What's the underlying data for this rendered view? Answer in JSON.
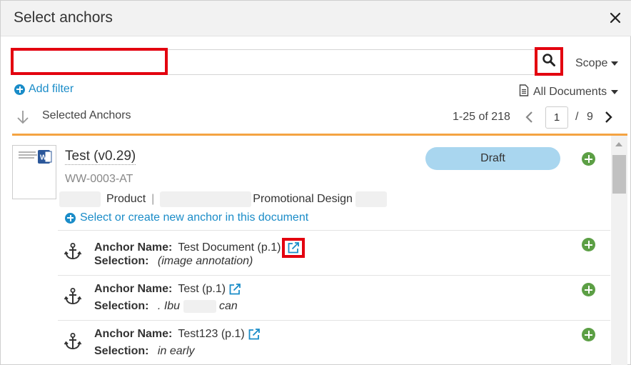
{
  "dialog": {
    "title": "Select anchors"
  },
  "search": {
    "value": "",
    "placeholder": "",
    "scope_label": "Scope"
  },
  "filters": {
    "add_filter_label": "Add filter",
    "all_documents_label": "All Documents"
  },
  "selection_bar": {
    "selected_label": "Selected Anchors",
    "range": "1-25 of 218",
    "current_page": "1",
    "separator": "/",
    "total_pages": "9"
  },
  "document": {
    "title": "Test (v0.29)",
    "id": "WW-0003-AT",
    "type": "Product",
    "subtype": "Promotional Design",
    "status": "Draft",
    "select_create_label": "Select or create new anchor in this document"
  },
  "anchors": [
    {
      "name_label": "Anchor Name:",
      "name": "Test Document (p.1)",
      "selection_label": "Selection:",
      "selection": "(image annotation)"
    },
    {
      "name_label": "Anchor Name:",
      "name": "Test (p.1)",
      "selection_label": "Selection:",
      "selection_pre": ". Ibu",
      "selection_post": "can"
    },
    {
      "name_label": "Anchor Name:",
      "name": "Test123 (p.1)",
      "selection_label": "Selection:",
      "selection": "in early"
    }
  ],
  "colors": {
    "accent_blue": "#1a8cc8",
    "orange_divider": "#f4a342",
    "draft_badge": "#a9d6ef",
    "add_green": "#5c9f45",
    "highlight_red": "#e3000f"
  }
}
